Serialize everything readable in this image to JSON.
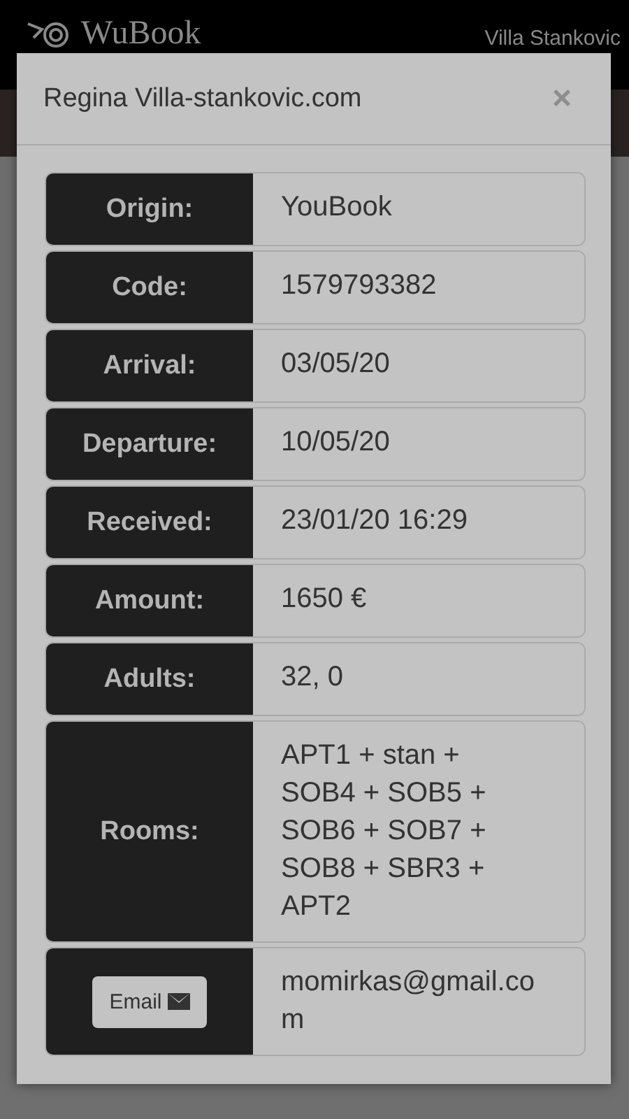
{
  "header": {
    "logo": "WuBook",
    "property": "Villa Stankovic"
  },
  "modal": {
    "title": "Regina Villa-stankovic.com",
    "close": "×",
    "rows": [
      {
        "kind": "text",
        "label": "Origin:",
        "value": "YouBook"
      },
      {
        "kind": "text",
        "label": "Code:",
        "value": "1579793382"
      },
      {
        "kind": "text",
        "label": "Arrival:",
        "value": "03/05/20"
      },
      {
        "kind": "text",
        "label": "Departure:",
        "value": "10/05/20"
      },
      {
        "kind": "text",
        "label": "Received:",
        "value": "23/01/20 16:29"
      },
      {
        "kind": "text",
        "label": "Amount:",
        "value": "1650 €"
      },
      {
        "kind": "text",
        "label": "Adults:",
        "value": "32, 0"
      },
      {
        "kind": "text",
        "label": "Rooms:",
        "value": "APT1 + stan + SOB4 + SOB5 + SOB6 + SOB7 + SOB8 + SBR3 + APT2"
      },
      {
        "kind": "button",
        "label": "Email",
        "value": "momirkas@gmail.com"
      }
    ]
  }
}
